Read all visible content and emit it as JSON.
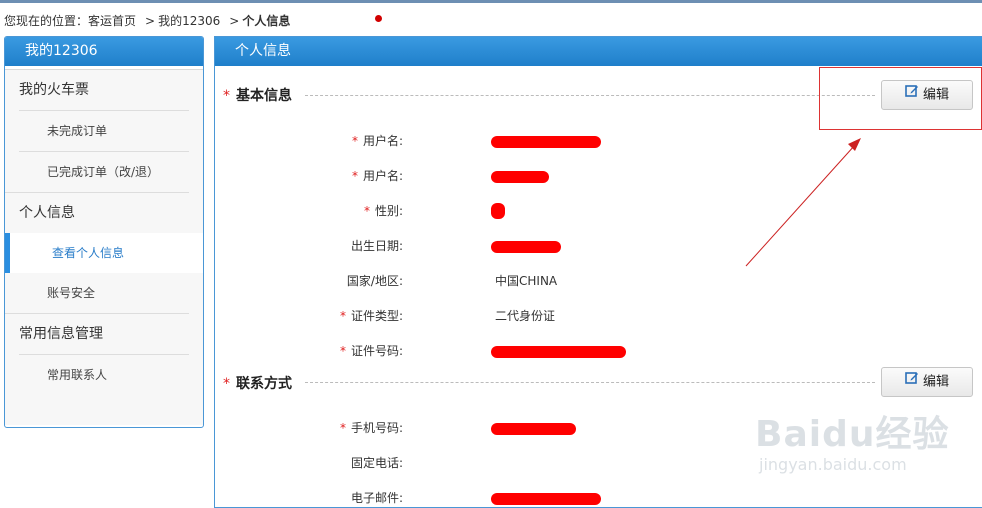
{
  "breadcrumb": {
    "prefix": "您现在的位置：",
    "items": [
      "客运首页",
      "我的12306",
      "个人信息"
    ]
  },
  "sidebar": {
    "title": "我的12306",
    "groups": [
      {
        "label": "我的火车票",
        "items": [
          {
            "label": "未完成订单"
          },
          {
            "label": "已完成订单（改/退）"
          }
        ]
      },
      {
        "label": "个人信息",
        "items": [
          {
            "label": "查看个人信息",
            "active": true
          },
          {
            "label": "账号安全"
          }
        ]
      },
      {
        "label": "常用信息管理",
        "items": [
          {
            "label": "常用联系人"
          }
        ]
      }
    ]
  },
  "main": {
    "title": "个人信息",
    "sections": [
      {
        "title": "基本信息",
        "edit_label": "编辑",
        "fields": [
          {
            "label": "用户名:",
            "required": true,
            "value": "",
            "redacted": true
          },
          {
            "label": "用户名:",
            "required": true,
            "value": "",
            "redacted": true
          },
          {
            "label": "性别:",
            "required": true,
            "value": "",
            "redacted": true
          },
          {
            "label": "出生日期:",
            "required": false,
            "value": "",
            "redacted": true
          },
          {
            "label": "国家/地区:",
            "required": false,
            "value": "中国CHINA",
            "redacted": false
          },
          {
            "label": "证件类型:",
            "required": true,
            "value": "二代身份证",
            "redacted": false
          },
          {
            "label": "证件号码:",
            "required": true,
            "value": "",
            "redacted": true
          }
        ]
      },
      {
        "title": "联系方式",
        "edit_label": "编辑",
        "fields": [
          {
            "label": "手机号码:",
            "required": true,
            "value": "",
            "redacted": true
          },
          {
            "label": "固定电话:",
            "required": false,
            "value": "",
            "redacted": false
          },
          {
            "label": "电子邮件:",
            "required": false,
            "value": "",
            "redacted": true
          }
        ]
      }
    ]
  },
  "watermark": {
    "logo": "Baidu经验",
    "url": "jingyan.baidu.com"
  },
  "colors": {
    "header_blue": "#2a8ee0",
    "required_star": "#e02020",
    "annotation_red": "#d33333",
    "redaction": "#ff0000"
  },
  "icons": {
    "edit": "edit-icon",
    "paw": "paw-icon"
  }
}
